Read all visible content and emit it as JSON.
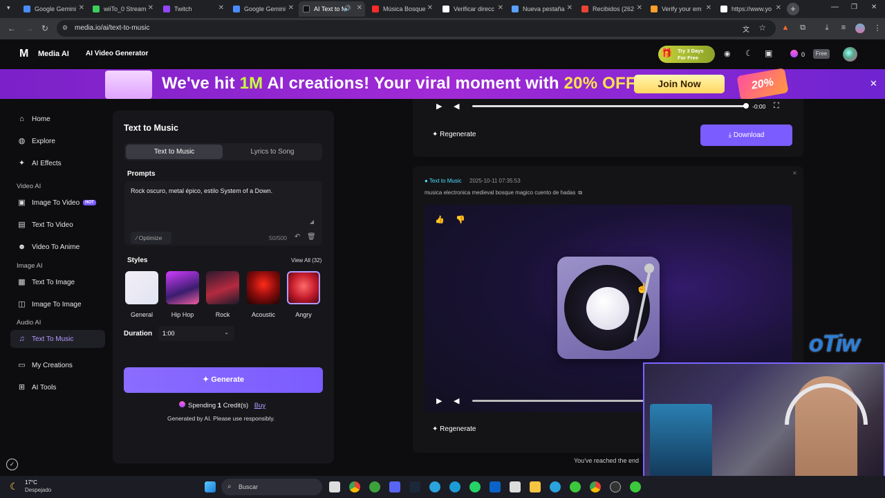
{
  "browser": {
    "tabs": [
      {
        "label": "Google Gemini"
      },
      {
        "label": "wiiTo_0 Stream"
      },
      {
        "label": "Twitch"
      },
      {
        "label": "Google Gemini"
      },
      {
        "label": "AI Text to M"
      },
      {
        "label": "Música Bosque"
      },
      {
        "label": "Verificar direcc"
      },
      {
        "label": "Nueva pestaña"
      },
      {
        "label": "Recibidos (262"
      },
      {
        "label": "Verify your em"
      },
      {
        "label": "https://www.yo"
      }
    ],
    "url": "media.io/ai/text-to-music"
  },
  "header": {
    "brand": "Media AI",
    "nav_item": "AI Video Generator",
    "trial_line1": "Try 3 Days",
    "trial_line2": "For Free",
    "credits": "0",
    "plan_badge": "Free"
  },
  "promo": {
    "text_a": "We've hit ",
    "text_b": "1M",
    "text_c": " AI creations! Your viral moment with ",
    "text_d": "20% OFF",
    "text_e": " !",
    "cta": "Join Now",
    "badge": "20%"
  },
  "sidebar": {
    "items": [
      {
        "label": "Home",
        "icon": "home-icon"
      },
      {
        "label": "Explore",
        "icon": "compass-icon"
      },
      {
        "label": "AI Effects",
        "icon": "sparkle-icon"
      }
    ],
    "section_video": "Video AI",
    "video_items": [
      {
        "label": "Image To Video",
        "badge": "HOT"
      },
      {
        "label": "Text To Video"
      },
      {
        "label": "Video To Anime"
      }
    ],
    "section_image": "Image AI",
    "image_items": [
      {
        "label": "Text To Image"
      },
      {
        "label": "Image To Image"
      }
    ],
    "section_audio": "Audio AI",
    "audio_items": [
      {
        "label": "Text To Music"
      }
    ],
    "bottom_items": [
      {
        "label": "My Creations"
      },
      {
        "label": "AI Tools"
      }
    ]
  },
  "panel": {
    "title": "Text to Music",
    "tab_active": "Text to Music",
    "tab_other": "Lyrics to Song",
    "prompts_label": "Prompts",
    "prompt_value": "Rock oscuro, metal épico, estilo System of a Down.",
    "optimize": "Optimize",
    "counter": "50/500",
    "styles_label": "Styles",
    "view_all": "View All (32)",
    "styles": [
      {
        "label": "General"
      },
      {
        "label": "Hip Hop"
      },
      {
        "label": "Rock"
      },
      {
        "label": "Acoustic"
      },
      {
        "label": "Angry"
      }
    ],
    "duration_label": "Duration",
    "duration_value": "1:00",
    "generate": "Generate",
    "spending_a": "Spending ",
    "spending_b": "1",
    "spending_c": " Credit(s)",
    "buy": "Buy",
    "disclaimer": "Generated by AI. Please use responsibly."
  },
  "result1": {
    "time": "-0:00",
    "progress": 1.0,
    "regenerate": "Regenerate",
    "download": "Download"
  },
  "result2": {
    "type": "Text to Music",
    "timestamp": "2025-10-11 07:35:53",
    "prompt": "musica electronica medieval bosque magico cuento de hadas",
    "regenerate": "Regenerate",
    "progress": 0.0
  },
  "end_text": "You've reached the end",
  "overlay_logo": "oTiw",
  "taskbar": {
    "temp": "17°C",
    "weather": "Despejado",
    "search": "Buscar"
  },
  "colors": {
    "accent": "#7b5cff",
    "promo": "#a12ad6"
  }
}
